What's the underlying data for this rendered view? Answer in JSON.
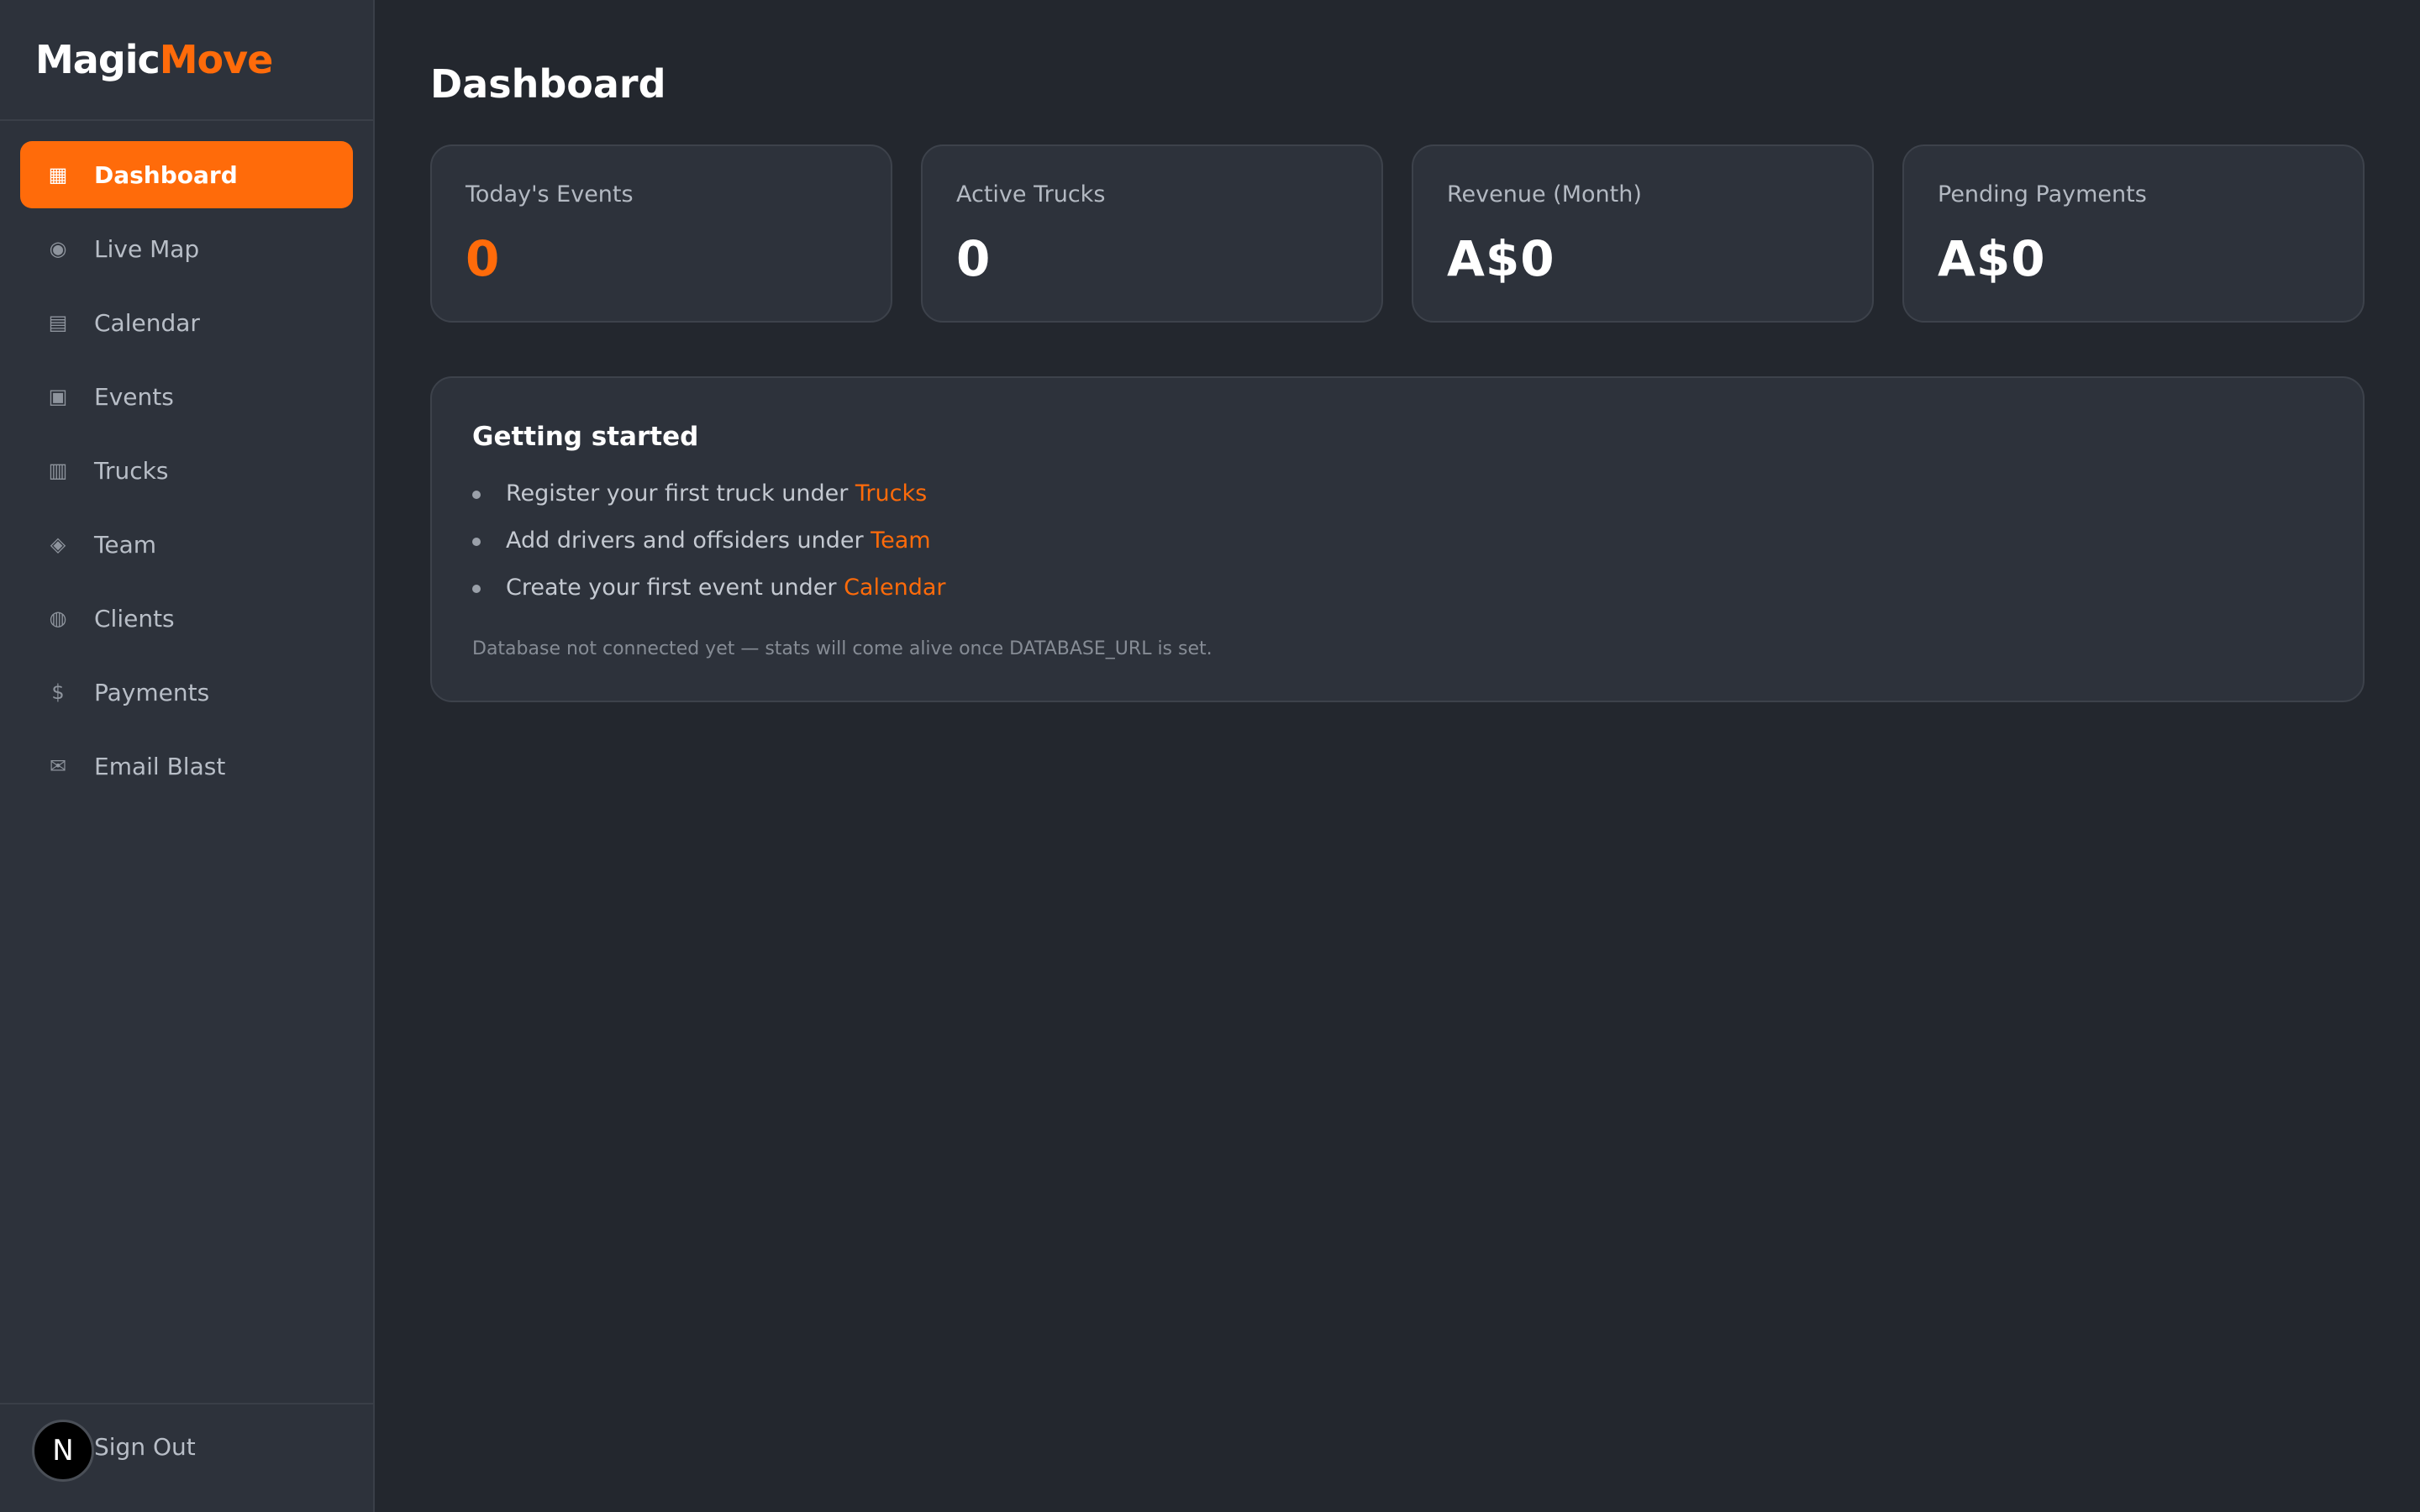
{
  "brand": {
    "part1": "Magic",
    "part2": "Move",
    "accent_color": "#ff6b0a"
  },
  "sidebar": {
    "items": [
      {
        "label": "Dashboard",
        "icon": "▦",
        "icon_name": "dashboard-icon",
        "active": true
      },
      {
        "label": "Live Map",
        "icon": "◉",
        "icon_name": "map-pin-icon",
        "active": false
      },
      {
        "label": "Calendar",
        "icon": "▤",
        "icon_name": "calendar-icon",
        "active": false
      },
      {
        "label": "Events",
        "icon": "▣",
        "icon_name": "events-icon",
        "active": false
      },
      {
        "label": "Trucks",
        "icon": "▥",
        "icon_name": "truck-icon",
        "active": false
      },
      {
        "label": "Team",
        "icon": "◈",
        "icon_name": "team-icon",
        "active": false
      },
      {
        "label": "Clients",
        "icon": "◍",
        "icon_name": "clients-icon",
        "active": false
      },
      {
        "label": "Payments",
        "icon": "$",
        "icon_name": "dollar-icon",
        "active": false
      },
      {
        "label": "Email Blast",
        "icon": "✉",
        "icon_name": "envelope-icon",
        "active": false
      }
    ],
    "footer": {
      "avatar_letter": "N",
      "signout_label": "Sign Out"
    }
  },
  "main": {
    "title": "Dashboard",
    "stats": [
      {
        "label": "Today's Events",
        "value": "0",
        "accent": true
      },
      {
        "label": "Active Trucks",
        "value": "0",
        "accent": false
      },
      {
        "label": "Revenue (Month)",
        "value": "A$0",
        "accent": false
      },
      {
        "label": "Pending Payments",
        "value": "A$0",
        "accent": false
      }
    ],
    "getting_started": {
      "title": "Getting started",
      "items": [
        {
          "text": "Register your first truck under ",
          "link": "Trucks"
        },
        {
          "text": "Add drivers and offsiders under ",
          "link": "Team"
        },
        {
          "text": "Create your first event under ",
          "link": "Calendar"
        }
      ],
      "note": "Database not connected yet — stats will come alive once DATABASE_URL is set."
    }
  }
}
